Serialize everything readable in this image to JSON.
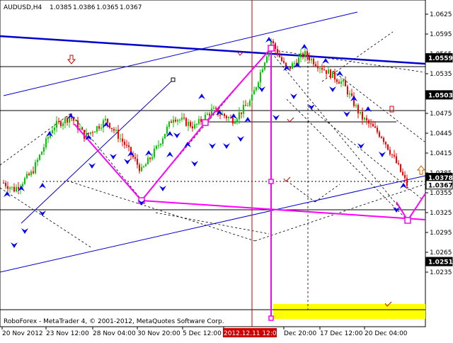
{
  "chart_data": {
    "type": "candlestick",
    "symbol_header": "AUDUSD,H4",
    "header_prices": [
      "1.0385",
      "1.0386",
      "1.0365",
      "1.0367"
    ],
    "footer_text": "RoboForex - MetaTrader 4, © 2001-2012, MetaQuotes Software Corp.",
    "ylim": [
      1.0235,
      1.064
    ],
    "y_ticks": [
      "1.0625",
      "1.0595",
      "1.0565",
      "1.0535",
      "1.0505",
      "1.0475",
      "1.0445",
      "1.0415",
      "1.0385",
      "1.0355",
      "1.0325",
      "1.0295",
      "1.0265",
      "1.0235"
    ],
    "x_ticks": [
      "20 Nov 2012",
      "23 Nov 12:00",
      "28 Nov 04:00",
      "30 Nov 20:00",
      "5 Dec 12:00",
      "2012.12.11 12:00",
      "Dec 20:00",
      "17 Dec 12:00",
      "20 Dec 04:00"
    ],
    "highlighted_x_tick": "2012.12.11 12:00",
    "price_labels": [
      {
        "text": "1.0559",
        "price": 1.0559,
        "style": "black"
      },
      {
        "text": "1.0503",
        "price": 1.0503,
        "style": "black"
      },
      {
        "text": "1.0378",
        "price": 1.0378,
        "style": "black"
      },
      {
        "text": "1.0367",
        "price": 1.0367,
        "style": "white"
      },
      {
        "text": "1.0251",
        "price": 1.0251,
        "style": "black"
      }
    ],
    "grid": false,
    "colors": {
      "bull": "#00cc00",
      "bear": "#ff0000",
      "trend": "#0000cc",
      "projection": "#ff00ff",
      "marker": "#0000ff",
      "vline": "#cc0000",
      "target": "#ffff00",
      "text": "#000000"
    }
  }
}
